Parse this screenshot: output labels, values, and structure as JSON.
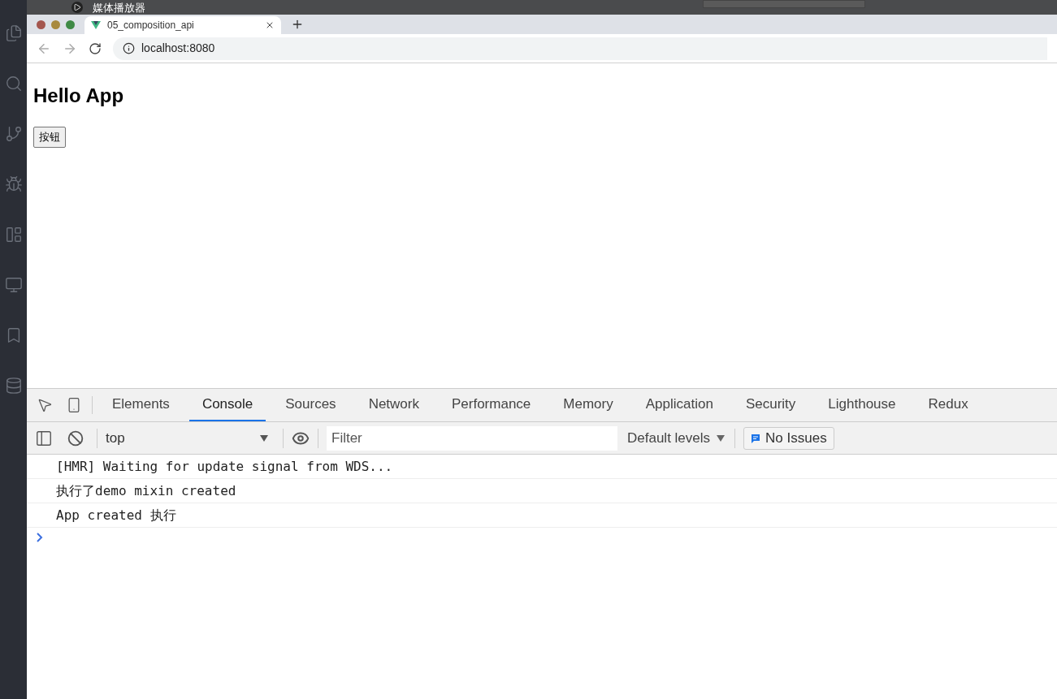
{
  "media_player": {
    "title": "媒体播放器"
  },
  "browser": {
    "tab": {
      "title": "05_composition_api"
    },
    "address": "localhost:8080"
  },
  "page": {
    "heading": "Hello App",
    "button": "按钮"
  },
  "devtools": {
    "tabs": [
      {
        "label": "Elements",
        "selected": false
      },
      {
        "label": "Console",
        "selected": true
      },
      {
        "label": "Sources",
        "selected": false
      },
      {
        "label": "Network",
        "selected": false
      },
      {
        "label": "Performance",
        "selected": false
      },
      {
        "label": "Memory",
        "selected": false
      },
      {
        "label": "Application",
        "selected": false
      },
      {
        "label": "Security",
        "selected": false
      },
      {
        "label": "Lighthouse",
        "selected": false
      },
      {
        "label": "Redux",
        "selected": false
      }
    ],
    "toolbar": {
      "context": "top",
      "filter_placeholder": "Filter",
      "levels": "Default levels",
      "issues": "No Issues"
    },
    "console": {
      "messages": [
        {
          "text": "[HMR] Waiting for update signal from WDS..."
        },
        {
          "text": "执行了demo mixin created"
        },
        {
          "text": "App created 执行"
        }
      ]
    }
  }
}
